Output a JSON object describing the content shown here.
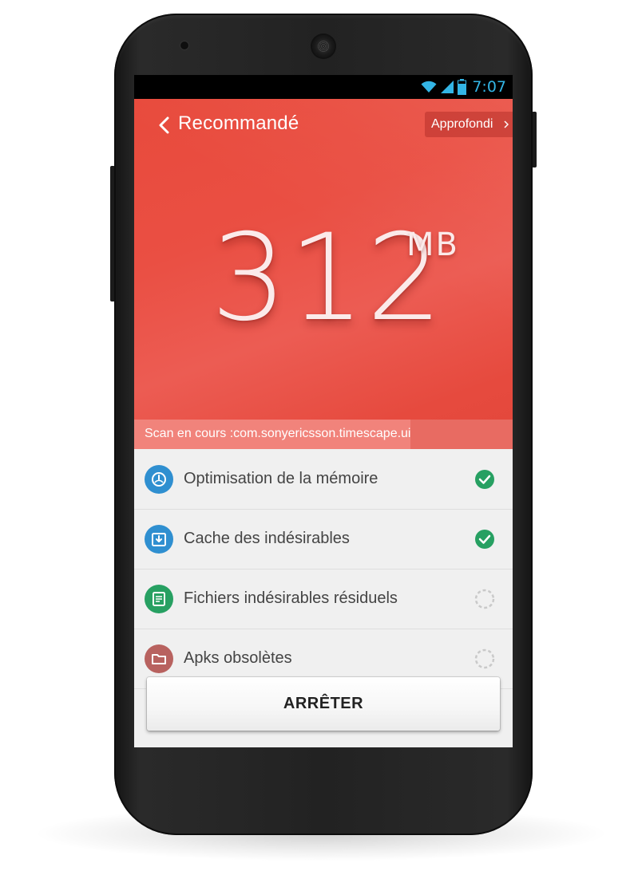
{
  "status_bar": {
    "time": "7:07",
    "icons": [
      "wifi-icon",
      "signal-icon",
      "battery-icon"
    ],
    "accent": "#33b5e5"
  },
  "header": {
    "title": "Recommandé",
    "back_icon": "back-chevron-icon",
    "action_label": "Approfondi"
  },
  "scan": {
    "size_value": "312",
    "size_unit": "MB",
    "status_text": "Scan en cours :com.sonyericsson.timescape.ui",
    "progress": 0.73
  },
  "items": [
    {
      "label": "Optimisation de la mémoire",
      "icon": "memory-gauge-icon",
      "icon_color": "#2f8fd0",
      "status": "done"
    },
    {
      "label": "Cache des indésirables",
      "icon": "cache-download-icon",
      "icon_color": "#2f8fd0",
      "status": "done"
    },
    {
      "label": "Fichiers indésirables résiduels",
      "icon": "residual-files-icon",
      "icon_color": "#27a062",
      "status": "pending"
    },
    {
      "label": "Apks obsolètes",
      "icon": "folder-icon",
      "icon_color": "#b8625f",
      "status": "pending"
    }
  ],
  "stop_button": {
    "label": "ARRÊTER"
  },
  "colors": {
    "hero_red": "#e84a3c",
    "check_green": "#27a062"
  }
}
